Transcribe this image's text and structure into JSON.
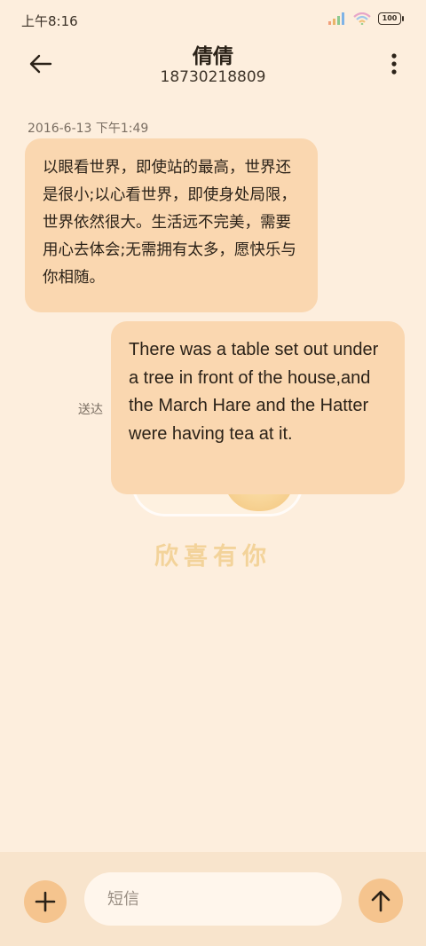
{
  "status_bar": {
    "time": "上午8:16",
    "battery": "100",
    "icons": [
      "signal-icon",
      "wifi-icon",
      "battery-icon"
    ]
  },
  "header": {
    "contact_name": "倩倩",
    "phone_number": "18730218809",
    "icons": [
      "back-arrow-icon",
      "more-vertical-icon"
    ]
  },
  "conversation": {
    "timestamp": "2016-6-13 下午1:49",
    "received_message": "以眼看世界，即使站的最高，世界还是很小;以心看世界，即使身处局限，世界依然很大。生活远不完美，需要用心去体会;无需拥有太多，愿快乐与你相随。",
    "sent_status": "送达",
    "sent_message": "There was a table set out under a tree in front of the house,and the March Hare and the Hatter were having tea at it."
  },
  "wallpaper": {
    "text": "欣喜有你"
  },
  "composer": {
    "placeholder": "短信",
    "icons": [
      "plus-icon",
      "send-arrow-icon"
    ]
  },
  "colors": {
    "background": "#fdeedd",
    "bubble": "#fad7b0",
    "accent_button": "#f5c48e",
    "bottom_bar": "#f8e4cc"
  }
}
